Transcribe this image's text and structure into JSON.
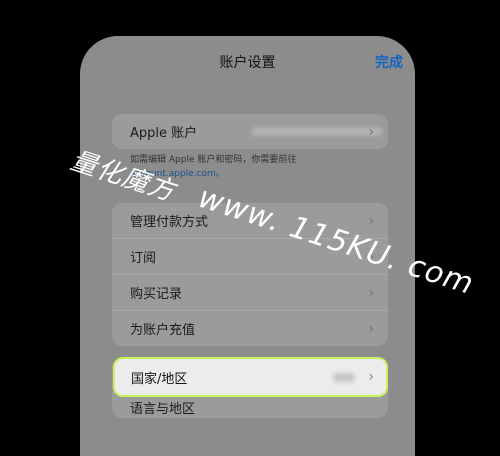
{
  "header": {
    "title": "账户设置",
    "done_label": "完成"
  },
  "account_section": {
    "label": "Apple 账户",
    "note_text": "如需编辑 Apple 账户和密码，你需要前往",
    "note_link": "account.apple.com。"
  },
  "payment_section": {
    "items": [
      {
        "label": "管理付款方式"
      },
      {
        "label": "订阅"
      },
      {
        "label": "购买记录"
      },
      {
        "label": "为账户充值"
      }
    ]
  },
  "country_section": {
    "label": "国家/地区",
    "next_label": "语言与地区"
  },
  "watermark": {
    "line1": "量化魔方",
    "line2": "www. 115KU. com"
  },
  "icons": {
    "chevron": "chevron-right-icon"
  },
  "colors": {
    "accent": "#1565c0",
    "highlight_border": "#c9f25b"
  }
}
